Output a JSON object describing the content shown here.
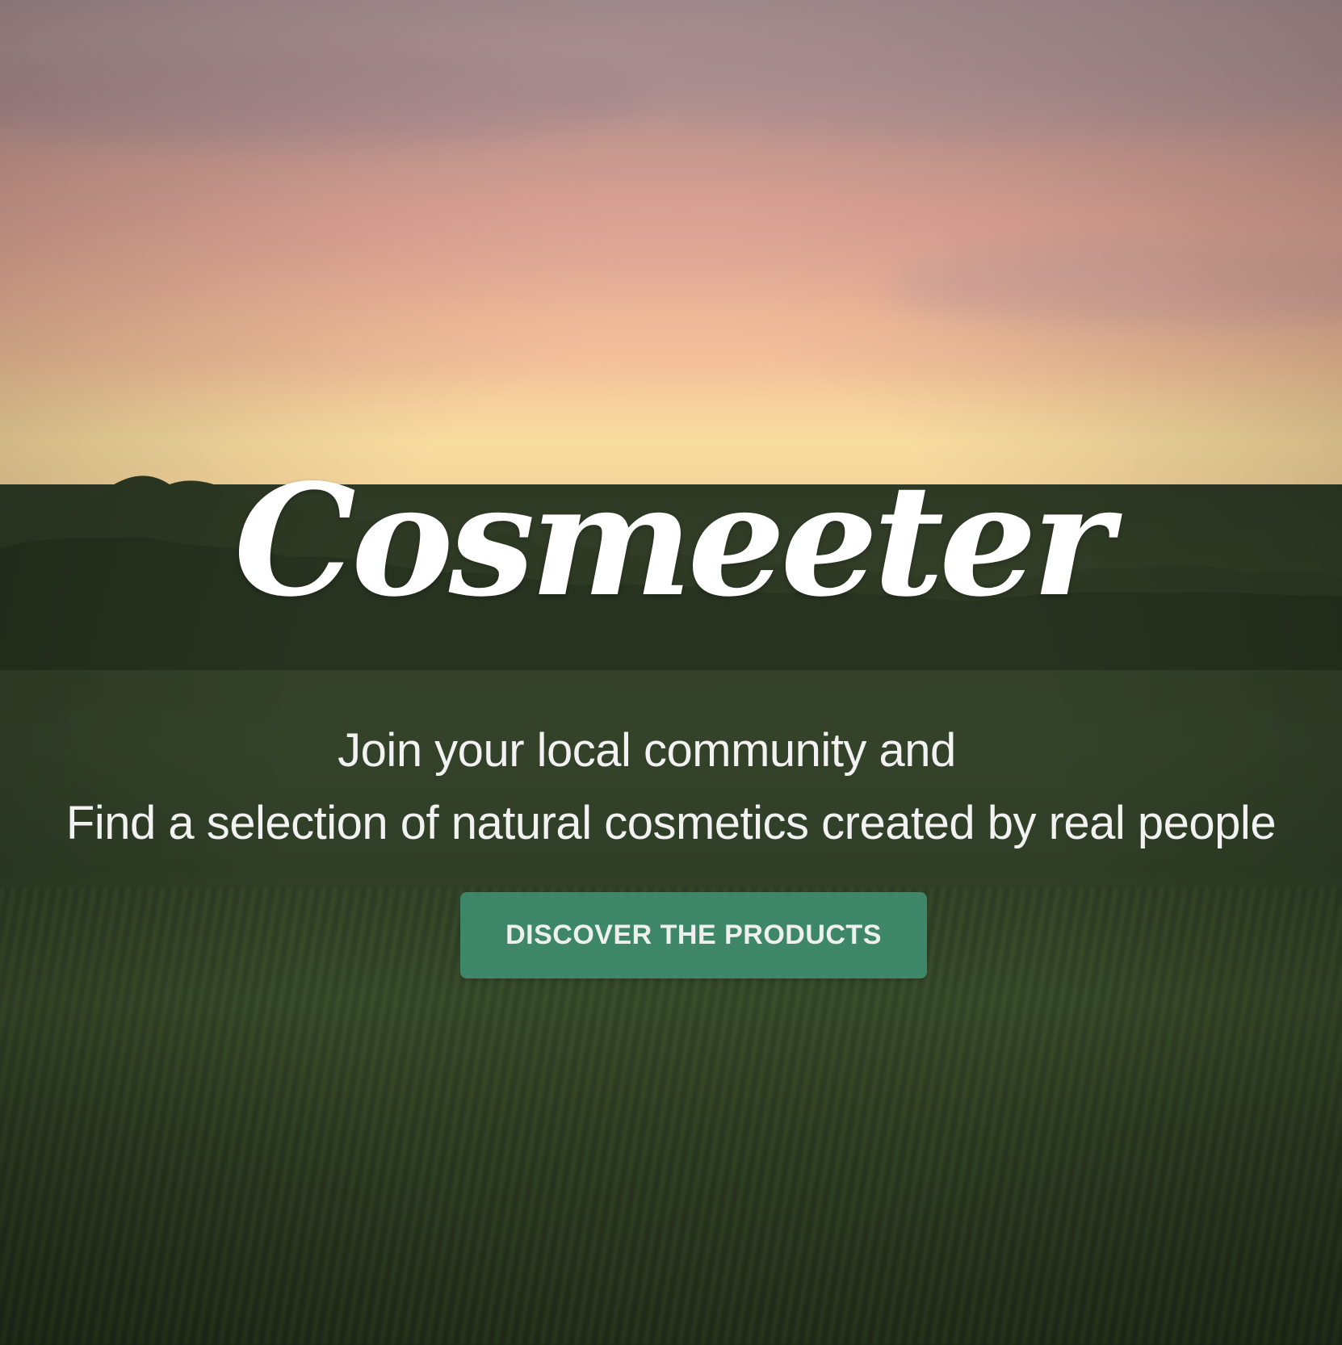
{
  "brand": {
    "logo_text": "Cosmeeter"
  },
  "hero": {
    "tagline_line1": "Join your local community and",
    "tagline_line2": "Find a selection of natural cosmetics created by real people",
    "cta_label": "DISCOVER THE PRODUCTS"
  },
  "colors": {
    "cta_background": "#3f8d6e",
    "text": "#ffffff"
  }
}
